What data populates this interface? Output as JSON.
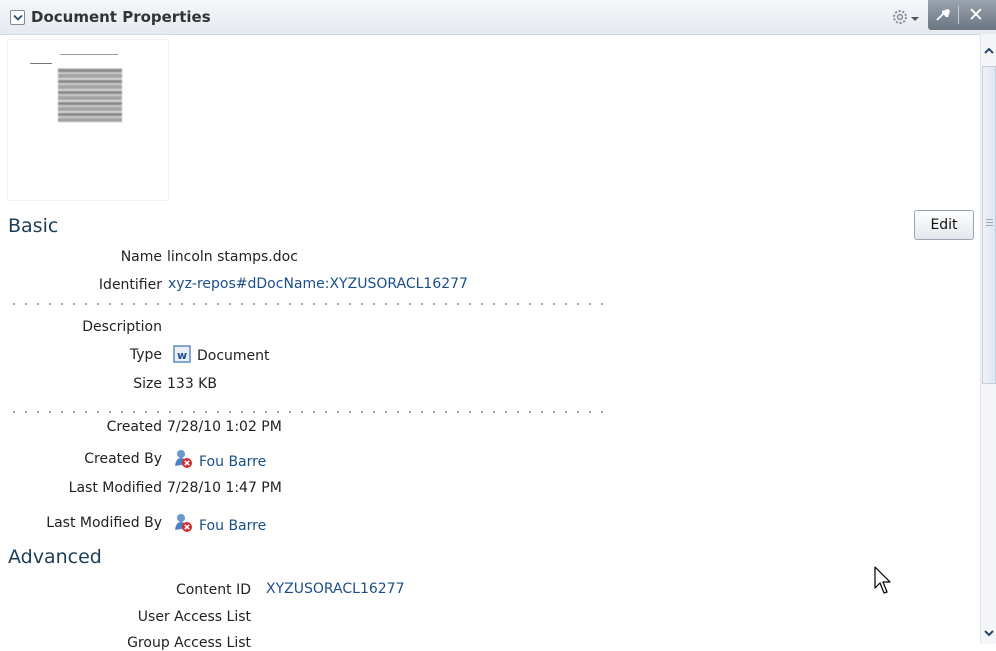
{
  "header": {
    "title": "Document Properties"
  },
  "basic": {
    "title": "Basic",
    "edit_label": "Edit",
    "name_label": "Name",
    "name_value": "lincoln stamps.doc",
    "identifier_label": "Identifier",
    "identifier_value": "xyz-repos#dDocName:XYZUSORACL16277",
    "description_label": "Description",
    "type_label": "Type",
    "type_value": "Document",
    "size_label": "Size",
    "size_value": "133 KB",
    "created_label": "Created",
    "created_value": "7/28/10 1:02 PM",
    "created_by_label": "Created By",
    "created_by_value": "Fou Barre",
    "last_modified_label": "Last Modified",
    "last_modified_value": "7/28/10 1:47 PM",
    "last_modified_by_label": "Last Modified By",
    "last_modified_by_value": "Fou Barre"
  },
  "advanced": {
    "title": "Advanced",
    "content_id_label": "Content ID",
    "content_id_value": "XYZUSORACL16277",
    "user_access_label": "User Access List",
    "group_access_label": "Group Access List"
  },
  "icons": {
    "collapse": "chevron-down-icon",
    "gear": "gear-icon",
    "pin": "pin-icon",
    "close": "close-icon",
    "word": "word-document-icon",
    "user": "user-icon"
  }
}
